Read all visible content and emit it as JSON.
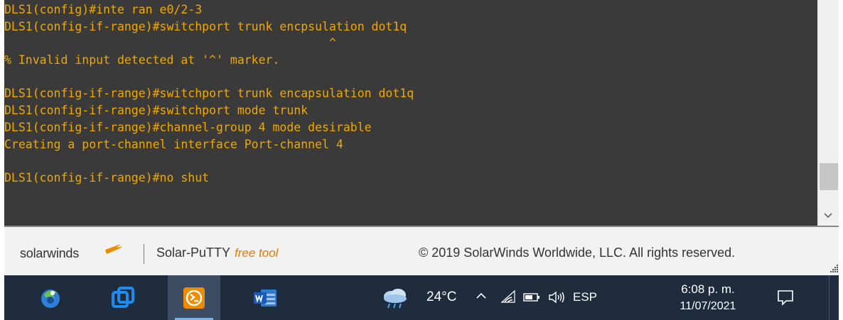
{
  "terminal": {
    "lines": [
      "DLS1(config)#inte ran e0/2-3",
      "DLS1(config-if-range)#switchport trunk encpsulation dot1q",
      "                                              ^",
      "% Invalid input detected at '^' marker.",
      "",
      "DLS1(config-if-range)#switchport trunk encapsulation dot1q",
      "DLS1(config-if-range)#switchport mode trunk",
      "DLS1(config-if-range)#channel-group 4 mode desirable",
      "Creating a port-channel interface Port-channel 4",
      "",
      "DLS1(config-if-range)#no shut",
      ""
    ],
    "text_color": "#f0a800",
    "background": "#3a3a3a",
    "scroll_position": 0.72
  },
  "footer": {
    "brand": "solarwinds",
    "product": "Solar-PuTTY",
    "product_tag": "free tool",
    "copyright": "© 2019 SolarWinds Worldwide, LLC. All rights reserved."
  },
  "taskbar": {
    "apps": [
      {
        "name": "browser-app-icon",
        "active": false
      },
      {
        "name": "teamviewer-icon",
        "active": false
      },
      {
        "name": "solar-putty-icon",
        "active": true
      },
      {
        "name": "word-icon",
        "active": false
      }
    ],
    "weather_icon": "rain-cloud-icon",
    "temperature": "24°C",
    "language": "ESP",
    "time": "6:08 p. m.",
    "date": "11/07/2021"
  }
}
